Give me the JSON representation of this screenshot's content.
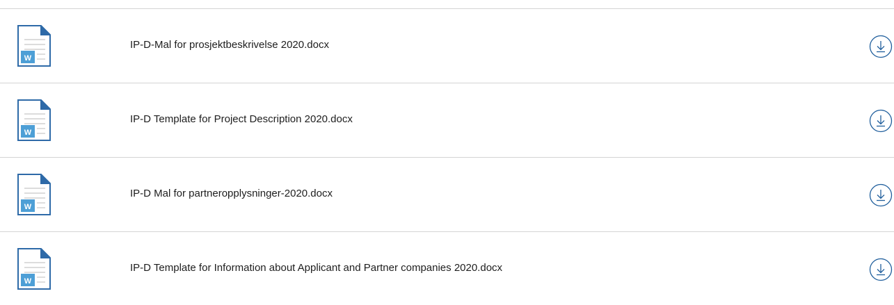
{
  "files": [
    {
      "name": "IP-D-Mal for prosjektbeskrivelse 2020.docx",
      "icon": "word-document-icon",
      "badge": "W"
    },
    {
      "name": "IP-D Template for Project Description 2020.docx",
      "icon": "word-document-icon",
      "badge": "W"
    },
    {
      "name": "IP-D Mal for partneropplysninger-2020.docx",
      "icon": "word-document-icon",
      "badge": "W"
    },
    {
      "name": "IP-D Template for Information about Applicant and Partner companies 2020.docx",
      "icon": "word-document-icon",
      "badge": "W"
    }
  ],
  "download_icon": "download-icon",
  "colors": {
    "doc_blue": "#2e6aa8",
    "badge_blue": "#4d9fd6",
    "divider": "#d4d4d4",
    "download_stroke": "#1f5e9c"
  }
}
